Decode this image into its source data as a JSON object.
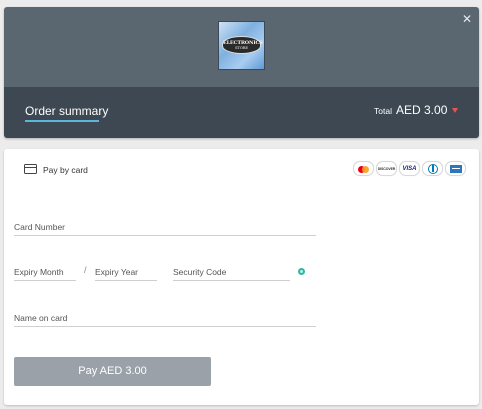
{
  "header": {
    "logo": {
      "line1": "ELECTRONICS",
      "line2": "STORE"
    },
    "order_summary_label": "Order summary",
    "total_label": "Total",
    "total_amount": "AED 3.00"
  },
  "payment": {
    "method_label": "Pay by card",
    "brands": [
      {
        "icon": "mastercard-icon"
      },
      {
        "icon": "discover-icon",
        "text": "DISCOVER"
      },
      {
        "icon": "visa-icon",
        "text": "VISA"
      },
      {
        "icon": "diners-club-icon"
      },
      {
        "icon": "amex-icon"
      }
    ],
    "fields": {
      "card_number": "Card Number",
      "expiry_month": "Expiry Month",
      "expiry_separator": "/",
      "expiry_year": "Expiry Year",
      "security_code": "Security Code",
      "name_on_card": "Name on card"
    },
    "pay_button_label": "Pay AED 3.00"
  },
  "colors": {
    "header_top": "#5a6670",
    "header_bottom": "#3d4852",
    "accent_underline": "#5bb6dc",
    "caret": "#e8544f",
    "help_icon": "#2fb6a6",
    "pay_button": "#9aa1a8"
  }
}
